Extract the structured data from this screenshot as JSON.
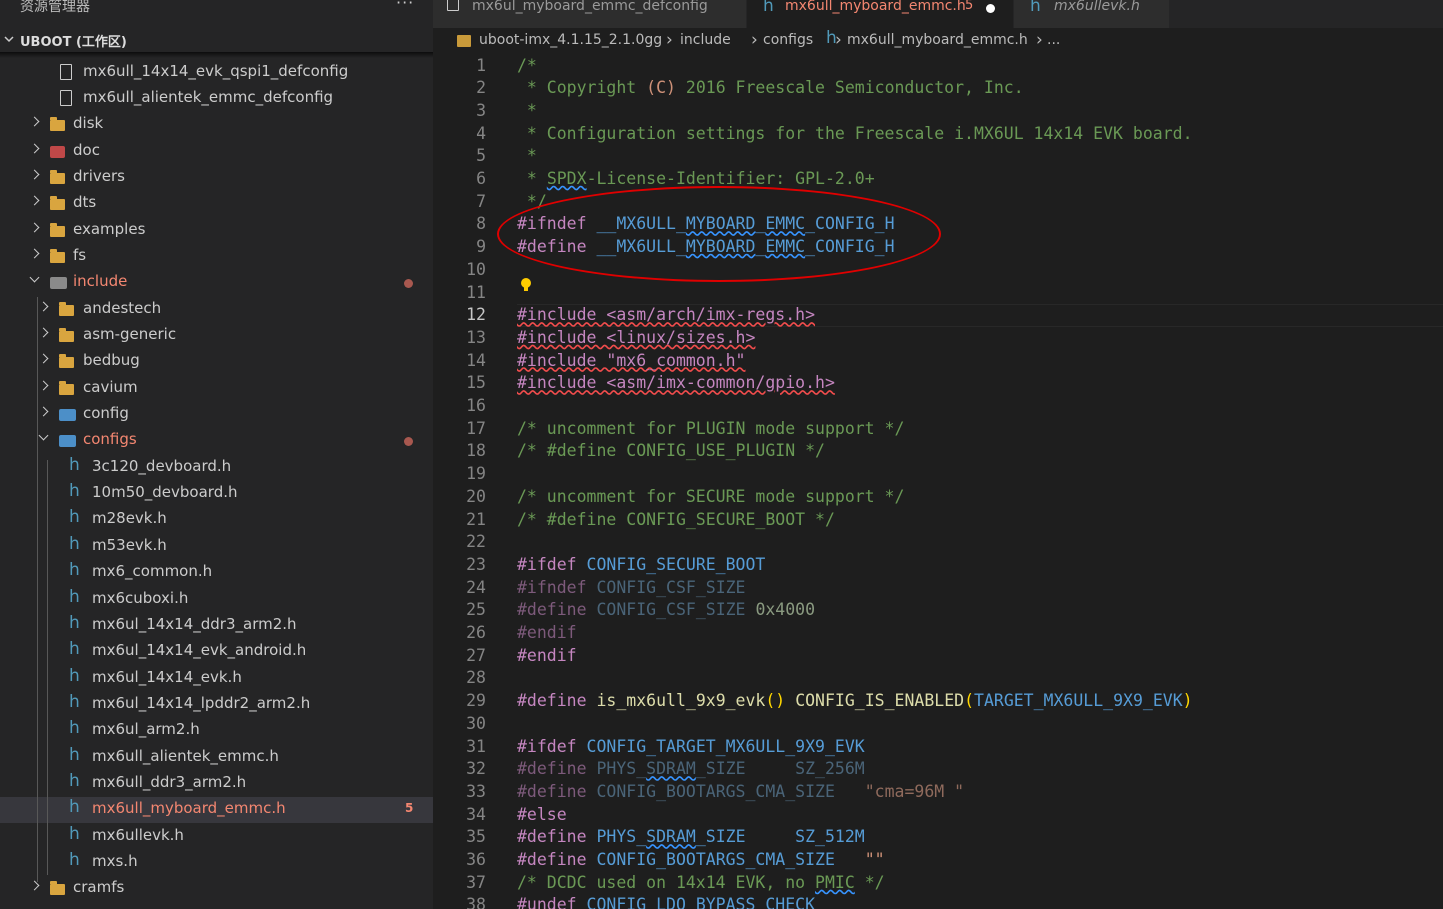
{
  "sidebar": {
    "title": "资源管理器",
    "more_label": "···",
    "workspace": "UBOOT (工作区)",
    "items": [
      {
        "label": "mx6ull_14x14_evk_qspi1_defconfig",
        "kind": "file",
        "depth": 2
      },
      {
        "label": "mx6ull_alientek_emmc_defconfig",
        "kind": "file",
        "depth": 2
      },
      {
        "label": "disk",
        "kind": "folder",
        "depth": 1,
        "expanded": false
      },
      {
        "label": "doc",
        "kind": "folder-doc",
        "depth": 1,
        "expanded": false
      },
      {
        "label": "drivers",
        "kind": "folder",
        "depth": 1,
        "expanded": false
      },
      {
        "label": "dts",
        "kind": "folder",
        "depth": 1,
        "expanded": false
      },
      {
        "label": "examples",
        "kind": "folder",
        "depth": 1,
        "expanded": false
      },
      {
        "label": "fs",
        "kind": "folder",
        "depth": 1,
        "expanded": false
      },
      {
        "label": "include",
        "kind": "folder-inc",
        "depth": 1,
        "expanded": true,
        "modified": true
      },
      {
        "label": "andestech",
        "kind": "folder",
        "depth": 2,
        "expanded": false
      },
      {
        "label": "asm-generic",
        "kind": "folder",
        "depth": 2,
        "expanded": false
      },
      {
        "label": "bedbug",
        "kind": "folder",
        "depth": 2,
        "expanded": false
      },
      {
        "label": "cavium",
        "kind": "folder",
        "depth": 2,
        "expanded": false
      },
      {
        "label": "config",
        "kind": "folder-cfg",
        "depth": 2,
        "expanded": false
      },
      {
        "label": "configs",
        "kind": "folder-cfg",
        "depth": 2,
        "expanded": true,
        "modified": true
      },
      {
        "label": "3c120_devboard.h",
        "kind": "h",
        "depth": 3
      },
      {
        "label": "10m50_devboard.h",
        "kind": "h",
        "depth": 3
      },
      {
        "label": "m28evk.h",
        "kind": "h",
        "depth": 3
      },
      {
        "label": "m53evk.h",
        "kind": "h",
        "depth": 3
      },
      {
        "label": "mx6_common.h",
        "kind": "h",
        "depth": 3
      },
      {
        "label": "mx6cuboxi.h",
        "kind": "h",
        "depth": 3
      },
      {
        "label": "mx6ul_14x14_ddr3_arm2.h",
        "kind": "h",
        "depth": 3
      },
      {
        "label": "mx6ul_14x14_evk_android.h",
        "kind": "h",
        "depth": 3
      },
      {
        "label": "mx6ul_14x14_evk.h",
        "kind": "h",
        "depth": 3
      },
      {
        "label": "mx6ul_14x14_lpddr2_arm2.h",
        "kind": "h",
        "depth": 3
      },
      {
        "label": "mx6ul_arm2.h",
        "kind": "h",
        "depth": 3
      },
      {
        "label": "mx6ull_alientek_emmc.h",
        "kind": "h",
        "depth": 3
      },
      {
        "label": "mx6ull_ddr3_arm2.h",
        "kind": "h",
        "depth": 3
      },
      {
        "label": "mx6ull_myboard_emmc.h",
        "kind": "h",
        "depth": 3,
        "selected": true,
        "modified": true,
        "badge": "5"
      },
      {
        "label": "mx6ullevk.h",
        "kind": "h",
        "depth": 3
      },
      {
        "label": "mxs.h",
        "kind": "h",
        "depth": 3
      },
      {
        "label": "cramfs",
        "kind": "folder",
        "depth": 1,
        "expanded": false
      }
    ]
  },
  "tabs": [
    {
      "label": "mx6ul_myboard_emmc_defconfig",
      "icon": "file-icon",
      "active": false
    },
    {
      "label": "mx6ull_myboard_emmc.h",
      "icon": "h-file-icon",
      "active": true,
      "badge": "5",
      "dirty": true
    },
    {
      "label": "mx6ullevk.h",
      "icon": "h-file-icon",
      "active": false,
      "italic": true
    }
  ],
  "breadcrumb": [
    "uboot-imx_4.1.15_2.1.0gg",
    "include",
    "configs",
    "mx6ull_myboard_emmc.h",
    "..."
  ],
  "editor": {
    "current_line": 12,
    "lines": [
      [
        [
          "c",
          "/*"
        ]
      ],
      [
        [
          "c",
          " * Copyright "
        ],
        [
          "cc",
          "(C)"
        ],
        [
          "c",
          " 2016 Freescale Semiconductor, Inc."
        ]
      ],
      [
        [
          "c",
          " *"
        ]
      ],
      [
        [
          "c",
          " * Configuration settings for the Freescale i.MX6UL 14x14 EVK board."
        ]
      ],
      [
        [
          "c",
          " *"
        ]
      ],
      [
        [
          "c",
          " * "
        ],
        [
          "c sq-b",
          "SPDX"
        ],
        [
          "c",
          "-License-Identifier: GPL-2.0+"
        ]
      ],
      [
        [
          "c",
          " */"
        ]
      ],
      [
        [
          "p",
          "#ifndef"
        ],
        [
          "d",
          " "
        ],
        [
          "m",
          "__MX6ULL_"
        ],
        [
          "m sq-b",
          "MYBOARD"
        ],
        [
          "m",
          "_"
        ],
        [
          "m sq-b",
          "EMMC"
        ],
        [
          "m",
          "_CONFIG_H"
        ]
      ],
      [
        [
          "p",
          "#define"
        ],
        [
          "d",
          " "
        ],
        [
          "m",
          "__MX6ULL_"
        ],
        [
          "m sq-b",
          "MYBOARD"
        ],
        [
          "m",
          "_"
        ],
        [
          "m sq-b",
          "EMMC"
        ],
        [
          "m",
          "_CONFIG_H"
        ]
      ],
      [],
      [],
      [
        [
          "p sq-r",
          "#include <asm/arch/imx-regs.h>"
        ]
      ],
      [
        [
          "p sq-r",
          "#include <linux/sizes.h>"
        ]
      ],
      [
        [
          "p sq-r",
          "#include \"mx6_common.h\""
        ]
      ],
      [
        [
          "p sq-r",
          "#include <asm/imx-common/gpio.h>"
        ]
      ],
      [],
      [
        [
          "c",
          "/* uncomment for PLUGIN mode support */"
        ]
      ],
      [
        [
          "c",
          "/* #define CONFIG_USE_PLUGIN */"
        ]
      ],
      [],
      [
        [
          "c",
          "/* uncomment for SECURE mode support */"
        ]
      ],
      [
        [
          "c",
          "/* #define CONFIG_SECURE_BOOT */"
        ]
      ],
      [],
      [
        [
          "p",
          "#ifdef"
        ],
        [
          "d",
          " "
        ],
        [
          "m",
          "CONFIG_SECURE_BOOT"
        ]
      ],
      [
        [
          "pd",
          "#ifndef"
        ],
        [
          "dd",
          " "
        ],
        [
          "md",
          "CONFIG_CSF_SIZE"
        ]
      ],
      [
        [
          "pd",
          "#define"
        ],
        [
          "dd",
          " "
        ],
        [
          "md",
          "CONFIG_CSF_SIZE"
        ],
        [
          "dd",
          " "
        ],
        [
          "nd",
          "0x4000"
        ]
      ],
      [
        [
          "pd",
          "#endif"
        ]
      ],
      [
        [
          "p",
          "#endif"
        ]
      ],
      [],
      [
        [
          "p",
          "#define"
        ],
        [
          "d",
          " "
        ],
        [
          "f",
          "is_mx6ull_9x9_evk"
        ],
        [
          "b",
          "()"
        ],
        [
          "d",
          " "
        ],
        [
          "f",
          "CONFIG_IS_ENABLED"
        ],
        [
          "b",
          "("
        ],
        [
          "m",
          "TARGET_MX6ULL_9X9_EVK"
        ],
        [
          "b",
          ")"
        ]
      ],
      [],
      [
        [
          "p",
          "#ifdef"
        ],
        [
          "d",
          " "
        ],
        [
          "m",
          "CONFIG_TARGET_MX6ULL_9X9_EVK"
        ]
      ],
      [
        [
          "pd",
          "#define"
        ],
        [
          "dd",
          " "
        ],
        [
          "md",
          "PHYS_"
        ],
        [
          "md sq-b",
          "SDRAM"
        ],
        [
          "md",
          "_SIZE"
        ],
        [
          "dd",
          "     "
        ],
        [
          "md",
          "SZ_256M"
        ]
      ],
      [
        [
          "pd",
          "#define"
        ],
        [
          "dd",
          " "
        ],
        [
          "md",
          "CONFIG_BOOTARGS_CMA_SIZE"
        ],
        [
          "dd",
          "   "
        ],
        [
          "sd",
          "\"cma=96M \""
        ]
      ],
      [
        [
          "p",
          "#else"
        ]
      ],
      [
        [
          "p",
          "#define"
        ],
        [
          "d",
          " "
        ],
        [
          "m",
          "PHYS_"
        ],
        [
          "m sq-b",
          "SDRAM"
        ],
        [
          "m",
          "_SIZE"
        ],
        [
          "d",
          "     "
        ],
        [
          "m",
          "SZ_512M"
        ]
      ],
      [
        [
          "p",
          "#define"
        ],
        [
          "d",
          " "
        ],
        [
          "m",
          "CONFIG_BOOTARGS_CMA_SIZE"
        ],
        [
          "d",
          "   "
        ],
        [
          "s",
          "\"\""
        ]
      ],
      [
        [
          "c",
          "/* DCDC used on 14x14 EVK, no "
        ],
        [
          "c sq-b",
          "PMIC"
        ],
        [
          "c",
          " */"
        ]
      ],
      [
        [
          "p",
          "#undef"
        ],
        [
          "d",
          " "
        ],
        [
          "m",
          "CONFIG_LDO_BYPASS_CHECK"
        ]
      ]
    ]
  }
}
